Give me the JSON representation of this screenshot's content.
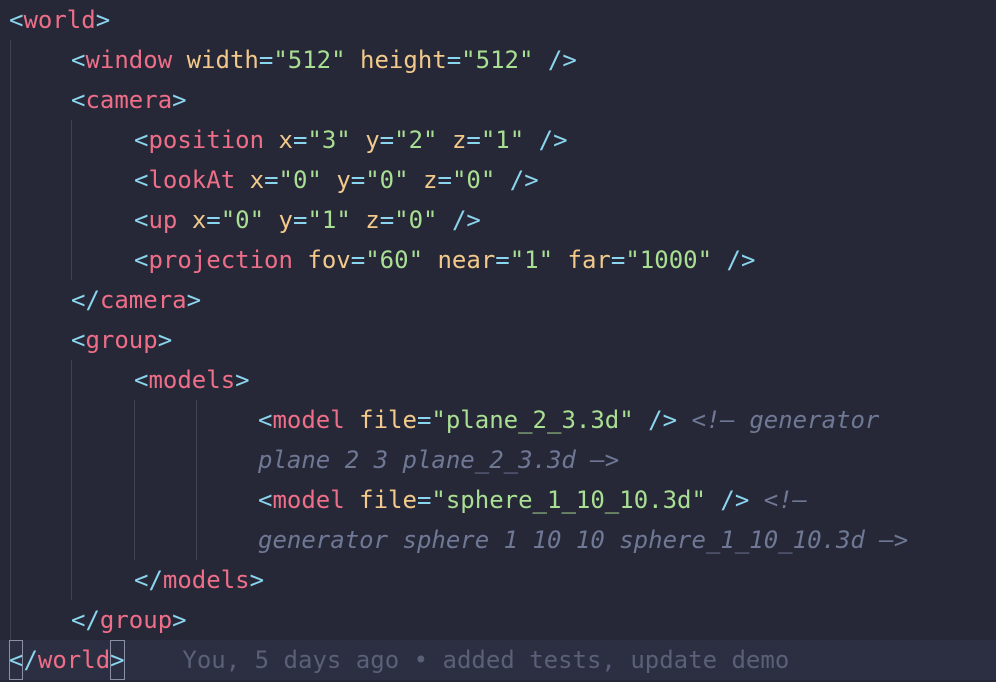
{
  "blame": "You, 5 days ago • added tests, update demo",
  "lines": {
    "world_open": {
      "name": "world"
    },
    "window": {
      "name": "window",
      "a1": "width",
      "v1": "\"512\"",
      "a2": "height",
      "v2": "\"512\""
    },
    "camera_open": {
      "name": "camera"
    },
    "position": {
      "name": "position",
      "a1": "x",
      "v1": "\"3\"",
      "a2": "y",
      "v2": "\"2\"",
      "a3": "z",
      "v3": "\"1\""
    },
    "lookat": {
      "name": "lookAt",
      "a1": "x",
      "v1": "\"0\"",
      "a2": "y",
      "v2": "\"0\"",
      "a3": "z",
      "v3": "\"0\""
    },
    "up": {
      "name": "up",
      "a1": "x",
      "v1": "\"0\"",
      "a2": "y",
      "v2": "\"1\"",
      "a3": "z",
      "v3": "\"0\""
    },
    "projection": {
      "name": "projection",
      "a1": "fov",
      "v1": "\"60\"",
      "a2": "near",
      "v2": "\"1\"",
      "a3": "far",
      "v3": "\"1000\""
    },
    "camera_close": {
      "name": "camera"
    },
    "group_open": {
      "name": "group"
    },
    "models_open": {
      "name": "models"
    },
    "model1": {
      "name": "model",
      "a1": "file",
      "v1": "\"plane_2_3.3d\"",
      "comment_start": "<!—",
      "comment_a": " generator",
      "comment_b": "plane 2 3 plane_2_3.3d",
      "comment_end": "—>"
    },
    "model2": {
      "name": "model",
      "a1": "file",
      "v1": "\"sphere_1_10_10.3d\"",
      "comment_start": "<!—",
      "comment_b": "generator sphere 1 10 10 sphere_1_10_10.3d",
      "comment_end": "—>"
    },
    "models_close": {
      "name": "models"
    },
    "group_close": {
      "name": "group"
    },
    "world_close": {
      "name": "world"
    }
  }
}
